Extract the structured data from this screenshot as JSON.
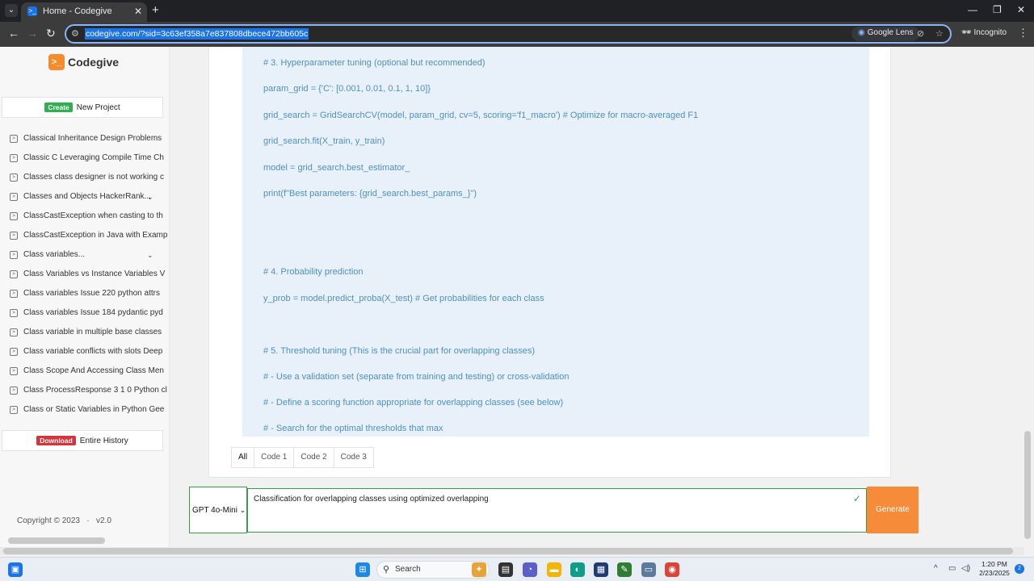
{
  "browser": {
    "tab_title": "Home - Codegive",
    "tab_favicon": ">_",
    "new_tab": "+",
    "url": "codegive.com/?sid=3c63ef358a7e837808dbece472bb605c",
    "lens_label": "Google Lens",
    "incognito_label": "Incognito",
    "controls": {
      "minimize": "—",
      "maximize": "❐",
      "close": "✕"
    }
  },
  "sidebar": {
    "logo_mark": ">_",
    "logo_text": "Codegive",
    "create_badge": "Create",
    "create_label": "New Project",
    "history_items": [
      {
        "label": "Classical Inheritance Design Problems",
        "chevron": ""
      },
      {
        "label": "Classic C Leveraging Compile Time Ch",
        "chevron": ""
      },
      {
        "label": "Classes class designer is not working c",
        "chevron": ""
      },
      {
        "label": "Classes and Objects HackerRank...",
        "chevron": "⌄"
      },
      {
        "label": "ClassCastException when casting to th",
        "chevron": ""
      },
      {
        "label": "ClassCastException in Java with Examp",
        "chevron": ""
      },
      {
        "label": "Class variables...",
        "chevron": "⌄"
      },
      {
        "label": "Class Variables vs Instance Variables V",
        "chevron": ""
      },
      {
        "label": "Class variables Issue 220 python attrs",
        "chevron": ""
      },
      {
        "label": "Class variables Issue 184 pydantic pyd",
        "chevron": ""
      },
      {
        "label": "Class variable in multiple base classes",
        "chevron": ""
      },
      {
        "label": "Class variable conflicts with slots Deep",
        "chevron": ""
      },
      {
        "label": "Class Scope And Accessing Class Men",
        "chevron": ""
      },
      {
        "label": "Class ProcessResponse 3 1 0 Python cl",
        "chevron": ""
      },
      {
        "label": "Class or Static Variables in Python Gee",
        "chevron": ""
      }
    ],
    "download_badge": "Download",
    "download_label": "Entire History",
    "copyright": "Copyright © 2023",
    "version_sep": "·",
    "version": "v2.0"
  },
  "code": {
    "lines": [
      "# 3. Hyperparameter tuning (optional but recommended)",
      "param_grid = {'C': [0.001, 0.01, 0.1, 1, 10]}",
      "grid_search = GridSearchCV(model, param_grid, cv=5, scoring='f1_macro') # Optimize for macro-averaged F1",
      "grid_search.fit(X_train, y_train)",
      "model = grid_search.best_estimator_",
      "print(f\"Best parameters: {grid_search.best_params_}\")",
      "# 4. Probability prediction",
      "y_prob = model.predict_proba(X_test)  # Get probabilities for each class",
      "# 5. Threshold tuning (This is the crucial part for overlapping classes)",
      "#  -  Use a validation set (separate from training and testing) or cross-validation",
      "#  -  Define a scoring function appropriate for overlapping classes (see below)",
      "#  -  Search for the optimal thresholds that max"
    ]
  },
  "tabs": [
    {
      "label": "All",
      "active": true
    },
    {
      "label": "Code 1",
      "active": false
    },
    {
      "label": "Code 2",
      "active": false
    },
    {
      "label": "Code 3",
      "active": false
    }
  ],
  "input": {
    "model_selected": "GPT 4o-Mini",
    "prompt_value": "Classification for overlapping classes using optimized overlapping",
    "generate_label": "Generate"
  },
  "taskbar": {
    "search_label": "Search",
    "time": "1:20 PM",
    "date": "2/23/2025",
    "notification_count": "2"
  },
  "colors": {
    "accent_orange": "#f68b3a",
    "create_green": "#2db14c",
    "download_red": "#d6333a",
    "code_text": "#4e8fc1",
    "code_bg": "#e8f1f9",
    "border_green": "#3a9b4a"
  }
}
